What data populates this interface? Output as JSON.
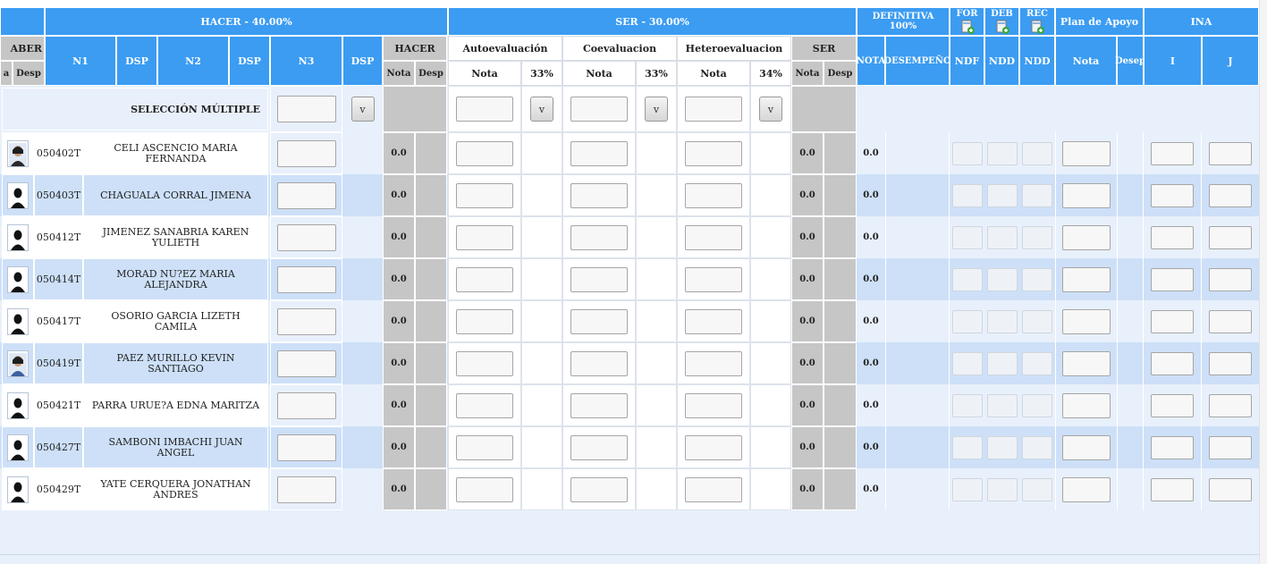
{
  "header": {
    "hacer_title": "HACER - 40.00%",
    "ser_title": "SER - 30.00%",
    "definitiva": "DEFINITIVA 100%",
    "for": "FOR",
    "deb": "DEB",
    "rec": "REC",
    "plan_apoyo": "Plan de Apoyo",
    "ina": "INA",
    "saber": "ABER",
    "saber_nota": "a",
    "saber_desp": "Desp",
    "n1": "N1",
    "dsp1": "DSP",
    "n2": "N2",
    "dsp2": "DSP",
    "n3": "N3",
    "dsp3": "DSP",
    "hacer": "HACER",
    "hacer_nota": "Nota",
    "hacer_desp": "Desp",
    "autoeval": "Autoevaluación",
    "auto_nota": "Nota",
    "auto_pct": "33%",
    "coeval": "Coevaluacion",
    "coe_nota": "Nota",
    "coe_pct": "33%",
    "heteroeval": "Heteroevaluacion",
    "het_nota": "Nota",
    "het_pct": "34%",
    "ser": "SER",
    "ser_nota": "Nota",
    "ser_desp": "Desp",
    "nota": "NOTA",
    "desempeno": "DESEMPEÑO",
    "ndf": "NDF",
    "ndd1": "NDD",
    "ndd2": "NDD",
    "plan_nota": "Nota",
    "plan_desp": "Desep",
    "ina_i": "I",
    "ina_j": "J"
  },
  "seleccion": {
    "label": "SELECCIÓN MÚLTIPLE",
    "btn": "v"
  },
  "students": [
    {
      "code": "050402T",
      "name": "CELI ASCENCIO MARIA FERNANDA",
      "hacer": "0.0",
      "ser": "0.0",
      "nota": "0.0",
      "photo": "photo"
    },
    {
      "code": "050403T",
      "name": "CHAGUALA CORRAL JIMENA",
      "hacer": "0.0",
      "ser": "0.0",
      "nota": "0.0",
      "photo": "silhouette"
    },
    {
      "code": "050412T",
      "name": "JIMENEZ SANABRIA KAREN YULIETH",
      "hacer": "0.0",
      "ser": "0.0",
      "nota": "0.0",
      "photo": "silhouette"
    },
    {
      "code": "050414T",
      "name": "MORAD NU?EZ MARIA ALEJANDRA",
      "hacer": "0.0",
      "ser": "0.0",
      "nota": "0.0",
      "photo": "silhouette"
    },
    {
      "code": "050417T",
      "name": "OSORIO GARCIA LIZETH CAMILA",
      "hacer": "0.0",
      "ser": "0.0",
      "nota": "0.0",
      "photo": "silhouette"
    },
    {
      "code": "050419T",
      "name": "PAEZ MURILLO KEVIN SANTIAGO",
      "hacer": "0.0",
      "ser": "0.0",
      "nota": "0.0",
      "photo": "photo"
    },
    {
      "code": "050421T",
      "name": "PARRA URUE?A EDNA MARITZA",
      "hacer": "0.0",
      "ser": "0.0",
      "nota": "0.0",
      "photo": "silhouette"
    },
    {
      "code": "050427T",
      "name": "SAMBONI IMBACHI JUAN ANGEL",
      "hacer": "0.0",
      "ser": "0.0",
      "nota": "0.0",
      "photo": "silhouette"
    },
    {
      "code": "050429T",
      "name": "YATE CERQUERA JONATHAN ANDRES",
      "hacer": "0.0",
      "ser": "0.0",
      "nota": "0.0",
      "photo": "silhouette"
    }
  ],
  "colors": {
    "header_blue": "#3b9cf2",
    "row_alt": "#cde0f8",
    "page_bg": "#e8f0fb",
    "gray": "#c6c6c6"
  }
}
